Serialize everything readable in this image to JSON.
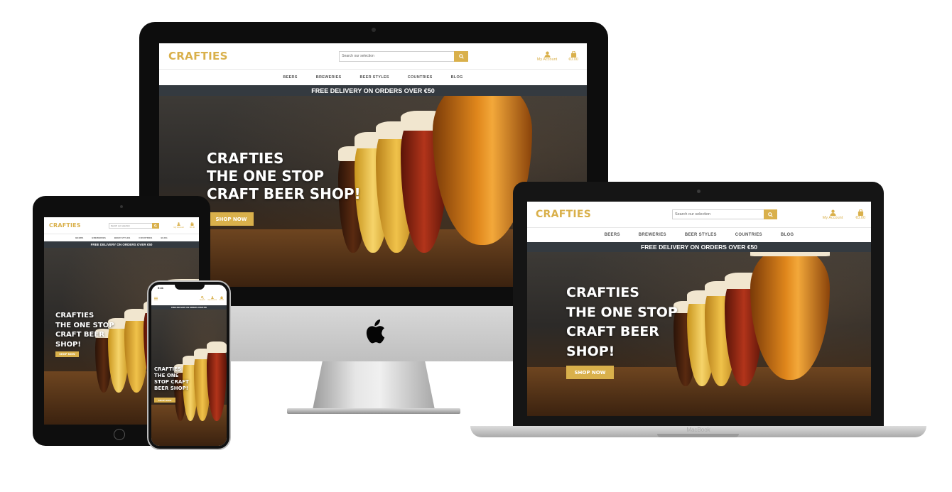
{
  "site": {
    "logo": "CRAFTIES",
    "search_placeholder": "Search our selection",
    "account_label": "My Account",
    "cart_total": "€0.00",
    "nav": [
      "BEERS",
      "BREWERIES",
      "BEER STYLES",
      "COUNTRIES",
      "BLOG"
    ],
    "banner": "FREE DELIVERY ON ORDERS OVER €50",
    "hero_lines_wide": [
      "CRAFTIES",
      "THE ONE STOP",
      "CRAFT BEER SHOP!"
    ],
    "hero_lines_laptop": [
      "CRAFTIES",
      "THE ONE STOP",
      "CRAFT BEER",
      "SHOP!"
    ],
    "hero_lines_tablet": [
      "CRAFTIES",
      "THE ONE STOP",
      "CRAFT BEER",
      "SHOP!"
    ],
    "hero_lines_phone": [
      "CRAFTIES",
      "THE ONE",
      "STOP CRAFT",
      "BEER SHOP!"
    ],
    "cta": "SHOP NOW"
  },
  "phone_status": {
    "time": "9:41"
  },
  "phone_icons": {
    "search": "Search",
    "account": "My Account",
    "cart": "€0.00"
  },
  "macbook_label": "MacBook",
  "colors": {
    "accent": "#d9b04b",
    "banner_bg": "#343a40",
    "device_black": "#0d0d0d"
  },
  "icons": [
    "search-icon",
    "user-icon",
    "shopping-bag-icon",
    "apple-logo-icon",
    "menu-icon"
  ]
}
